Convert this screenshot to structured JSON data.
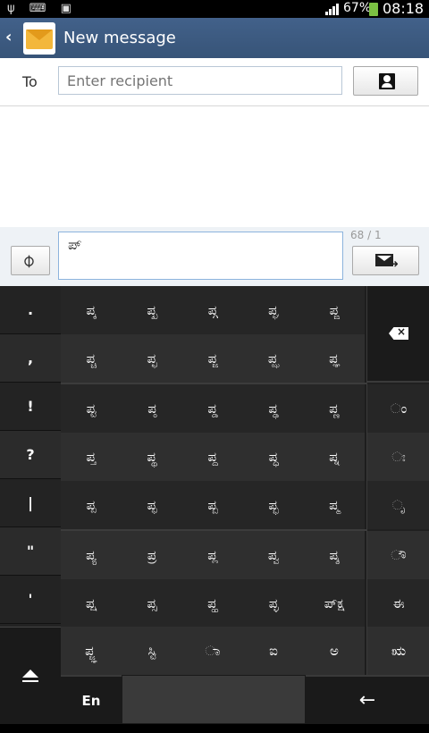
{
  "status": {
    "left_icons": "ψ ⌨ ▣",
    "battery": "67%",
    "time": "08:18"
  },
  "header": {
    "back": "‹",
    "title": "New message"
  },
  "to_row": {
    "label": "To",
    "placeholder": "Enter recipient"
  },
  "compose": {
    "text": "ಪ್",
    "counter": "68 / 1",
    "attach_icon": "paperclip-icon",
    "send_icon": "send-message-icon"
  },
  "keyboard": {
    "left_symbols": [
      ".",
      ",",
      "!",
      "?",
      "|",
      "\"",
      "'"
    ],
    "rows": [
      [
        "ಪ್ಕ",
        "ಪ್ಖ",
        "ಪ್ಗ",
        "ಪ್ಘ",
        "ಪ್ಙ"
      ],
      [
        "ಪ್ಚ",
        "ಪ್ಛ",
        "ಪ್ಜ",
        "ಪ್ಝ",
        "ಪ್ಞ"
      ],
      [
        "ಪ್ಟ",
        "ಪ್ಠ",
        "ಪ್ಡ",
        "ಪ್ಢ",
        "ಪ್ಣ"
      ],
      [
        "ಪ್ತ",
        "ಪ್ಥ",
        "ಪ್ದ",
        "ಪ್ಧ",
        "ಪ್ನ"
      ],
      [
        "ಪ್ಪ",
        "ಪ್ಫ",
        "ಪ್ಬ",
        "ಪ್ಭ",
        "ಪ್ಮ"
      ],
      [
        "ಪ್ಯ",
        "ಪ್ರ",
        "ಪ್ಲ",
        "ಪ್ವ",
        "ಪ್ಶ"
      ],
      [
        "ಪ್ಷ",
        "ಪ್ಸ",
        "ಪ್ಹ",
        "ಪ್ಳ",
        "ಪ್ಕ್ಷ"
      ],
      [
        "ಪ್ಜ್ಞ",
        "ಸ್ಟಿ",
        "ಾ",
        "ಐ",
        "ಅ"
      ]
    ],
    "right_keys": [
      "ಂ",
      "ಃ",
      "ೃ",
      "ೌ",
      "ಈ",
      "ಋ"
    ],
    "lang": "En",
    "enter": "←"
  }
}
